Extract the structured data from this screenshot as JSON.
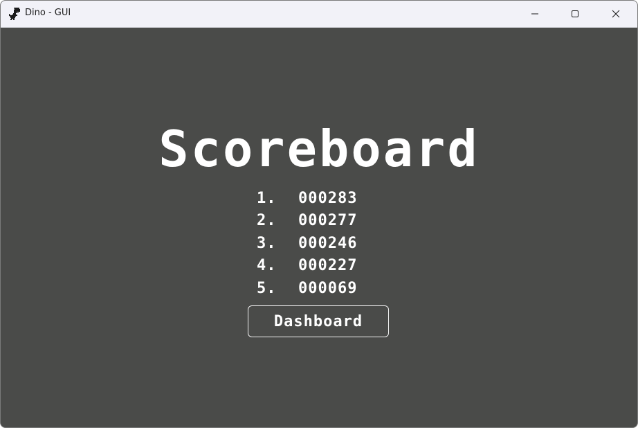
{
  "window": {
    "title": "Dino - GUI",
    "icon": "dino-icon",
    "controls": [
      "minimize-icon",
      "maximize-icon",
      "close-icon"
    ]
  },
  "colors": {
    "background": "#4a4b49",
    "text": "#ffffff",
    "titlebar": "#f2f2f8"
  },
  "heading": "Scoreboard",
  "scores": [
    {
      "rank": "1.",
      "value": "000283"
    },
    {
      "rank": "2.",
      "value": "000277"
    },
    {
      "rank": "3.",
      "value": "000246"
    },
    {
      "rank": "4.",
      "value": "000227"
    },
    {
      "rank": "5.",
      "value": "000069"
    }
  ],
  "dashboard_button": "Dashboard"
}
